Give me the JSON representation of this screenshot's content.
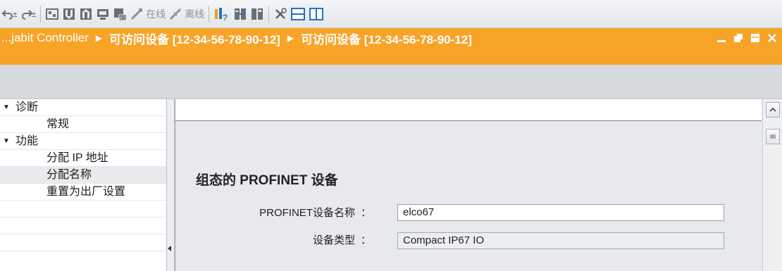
{
  "toolbar": {
    "online_label": "在线",
    "offline_label": "离线"
  },
  "breadcrumb": {
    "items": [
      {
        "label": "...jabit Controller",
        "bold": false
      },
      {
        "label": "可访问设备 [12-34-56-78-90-12]",
        "bold": true
      },
      {
        "label": "可访问设备 [12-34-56-78-90-12]",
        "bold": true
      }
    ],
    "separator": "▶"
  },
  "nav": {
    "items": [
      {
        "label": "诊断",
        "level": 0,
        "expanded": true,
        "selected": false
      },
      {
        "label": "常规",
        "level": 1,
        "expanded": null,
        "selected": false
      },
      {
        "label": "功能",
        "level": 0,
        "expanded": true,
        "selected": false
      },
      {
        "label": "分配 IP 地址",
        "level": 1,
        "expanded": null,
        "selected": false
      },
      {
        "label": "分配名称",
        "level": 1,
        "expanded": null,
        "selected": true
      },
      {
        "label": "重置为出厂设置",
        "level": 1,
        "expanded": null,
        "selected": false
      },
      {
        "label": "",
        "level": 1,
        "expanded": null,
        "selected": false
      },
      {
        "label": "",
        "level": 1,
        "expanded": null,
        "selected": false
      },
      {
        "label": "",
        "level": 1,
        "expanded": null,
        "selected": false
      }
    ]
  },
  "main": {
    "section_title": "组态的 PROFINET 设备",
    "fields": {
      "device_name": {
        "label": "PROFINET设备名称",
        "colon": "：",
        "value": "elco67"
      },
      "device_type": {
        "label": "设备类型",
        "colon": "：",
        "value": "Compact IP67 IO"
      }
    }
  },
  "colors": {
    "title_bar": "#f7a429",
    "panel_bg": "#e7e9ec",
    "nav_bg": "#ffffff"
  }
}
